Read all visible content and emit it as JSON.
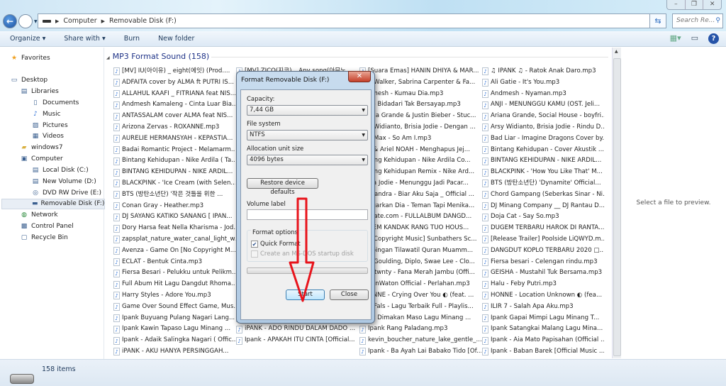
{
  "window": {
    "buttons": {
      "minimize": "–",
      "maximize": "❐",
      "close": "✕"
    }
  },
  "address": {
    "root": "Computer",
    "current": "Removable Disk (F:)",
    "search_placeholder": "Search Re..."
  },
  "toolbar": {
    "organize": "Organize ▾",
    "share": "Share with ▾",
    "burn": "Burn",
    "new_folder": "New folder"
  },
  "sidebar": {
    "items": [
      {
        "label": "Favorites",
        "icon": "star-icon"
      },
      {
        "label": "Desktop",
        "icon": "desktop-icon"
      },
      {
        "label": "Libraries",
        "icon": "libraries-icon"
      },
      {
        "label": "Documents",
        "icon": "documents-icon"
      },
      {
        "label": "Music",
        "icon": "music-icon"
      },
      {
        "label": "Pictures",
        "icon": "pictures-icon"
      },
      {
        "label": "Videos",
        "icon": "videos-icon"
      },
      {
        "label": "windows7",
        "icon": "user-folder-icon"
      },
      {
        "label": "Computer",
        "icon": "computer-icon"
      },
      {
        "label": "Local Disk (C:)",
        "icon": "disk-icon"
      },
      {
        "label": "New Volume (D:)",
        "icon": "disk-icon"
      },
      {
        "label": "DVD RW Drive (E:)",
        "icon": "dvd-icon"
      },
      {
        "label": "Removable Disk (F:)",
        "icon": "usb-drive-icon",
        "selected": true
      },
      {
        "label": "Network",
        "icon": "network-icon"
      },
      {
        "label": "Control Panel",
        "icon": "control-panel-icon"
      },
      {
        "label": "Recycle Bin",
        "icon": "recycle-bin-icon"
      }
    ]
  },
  "content": {
    "group_title": "MP3 Format Sound (158)",
    "columns": [
      [
        "[MV] IU(아이유) _ eight(에잇) (Prod....",
        "ADFAITA cover by ALMA ft PUTRI IS...",
        "ALLAHUL KAAFI _ FITRIANA feat NIS...",
        "Andmesh Kamaleng - Cinta Luar Bia...",
        "ANTASSALAM cover ALMA feat NIS...",
        "Arizona Zervas - ROXANNE.mp3",
        "AURELIE HERMANSYAH - KEPASTIA...",
        "Badai Romantic Project - Melamarm...",
        "Bintang Kehidupan - Nike Ardila ( Ta...",
        "BINTANG KEHIDUPAN - NIKE ARDIL...",
        "BLACKPINK - 'Ice Cream (with Selen...",
        "BTS (방탄소년단) '작은 것들을 위한 ...",
        "Conan Gray - Heather.mp3",
        "DJ SAYANG KATIKO SANANG [ IPAN...",
        "Dory Harsa feat Nella Kharisma - Jod...",
        "zapsplat_nature_water_canal_light_w...",
        "Avenza - Game On [No Copyright M...",
        "ECLAT - Bentuk Cinta.mp3",
        "Fiersa Besari - Pelukku untuk Pelikm...",
        "Full Abum Hit Lagu Dangdut Rhoma...",
        "Harry Styles - Adore You.mp3",
        "Game Over Sound Effect Game, Mus...",
        "Ipank   Buyuang Pulang Nagari Lang...",
        "Ipank   Kawin Tapaso Lagu Minang ...",
        "Ipank - Adaik Salingka Nagari ( Offic...",
        "iPANK - AKU HANYA PERSINGGAH..."
      ],
      [
        "[MV] ZICO(지코) _ Any song(아무노...",
        "",
        "",
        "",
        "",
        "",
        "",
        "",
        "",
        "",
        "",
        "",
        "",
        "",
        "",
        "",
        "",
        "",
        "",
        "",
        "",
        "",
        "Ipank   Maafkan Mande Lagu Minan...",
        "iPANK - ADO RINDU DALAM DADO ...",
        "Ipank - APAKAH ITU CINTA [Official..."
      ],
      [
        "[Suara Emas] HANIN DHIYA & MAR...",
        "n Walker, Sabrina Carpenter & Fa...",
        "dmesh - Kumau Dia.mp3",
        "ji - Bidadari Tak Bersayap.mp3",
        "ana Grande & Justin Bieber - Stuc...",
        "y Widianto, Brisia Jodie - Dengan ...",
        "a Max - So Am I.mp3",
        "L & Ariel NOAH - Menghapus Jej...",
        "tang Kehidupan - Nike Ardila Co...",
        "tang Kehidupan Remix - Nike Ard...",
        "sia Jodie - Menunggu Jadi Pacar...",
        "ssandra - Biar Aku Saja _ Official ...",
        "ngarkan Dia - Teman Tapi Menika...",
        "mate.com - FULLALBUM DANGD...",
        "GEM KANDAK RANG TUO HOUS...",
        "o Copyright Music] Sunbathers Sc...",
        "nbingan Tilawatil Quran Muamm...",
        "e Goulding, Diplo, Swae Lee - Clo...",
        "urtwnty - Fana Merah Jambu (Offi...",
        "yonWaton Official - Perlahan.mp3",
        "ONNE - Crying Over You ◐ (feat. ...",
        "n Fals - Lagu Terbaik Full - Playlis...",
        "nk   Dimakan Maso Lagu Minang ...",
        "Ipank   Rang Paladang.mp3",
        "kevin_boucher_nature_lake_gentle_...",
        "Ipank - Ba Ayah Lai Babako Tido [Of..."
      ],
      [
        "♫ IPANK ♫ - Ratok Anak Daro.mp3",
        "Ali Gatie - It's You.mp3",
        "Andmesh - Nyaman.mp3",
        "ANJI - MENUNGGU KAMU (OST. Jeli...",
        "Ariana Grande, Social House - boyfri...",
        "Arsy Widianto, Brisia Jodie - Rindu D...",
        "Bad Liar - Imagine Dragons Cover by...",
        "Bintang Kehidupan - Cover Akustik ...",
        "BINTANG KEHIDUPAN - NIKE ARDIL...",
        "BLACKPINK - 'How You Like That' M...",
        "BTS (방탄소년단) 'Dynamite' Official...",
        "Chord Gampang (Seberkas Sinar - Ni...",
        "DJ Minang Company __ DJ Rantau D...",
        "Doja Cat - Say So.mp3",
        "DUGEM TERBARU HAROK DI RANTA...",
        "[Release Trailer] Poolside LiQWYD.m...",
        "DANGDUT KOPLO TERBARU 2020 □...",
        "Fiersa besari - Celengan rindu.mp3",
        "GEISHA - Mustahil Tuk Bersama.mp3",
        "Halu - Feby Putri.mp3",
        "HONNE - Location Unknown ◐ (fea...",
        "ILIR 7 - Salah Apa Aku.mp3",
        "Ipank   Gapai Mimpi Lagu Minang T...",
        "Ipank   Satangkai Malang Lagu Mina...",
        "Ipank - Aia Mato Papisahan (Official ...",
        "Ipank - Baban Barek [Official Music ..."
      ]
    ]
  },
  "preview": {
    "text": "Select a file to preview."
  },
  "status": {
    "count": "158 items"
  },
  "dialog": {
    "title": "Format Removable Disk (F:)",
    "close": "✕",
    "capacity_label": "Capacity:",
    "capacity_value": "7,44 GB",
    "fs_label": "File system",
    "fs_value": "NTFS",
    "alloc_label": "Allocation unit size",
    "alloc_value": "4096 bytes",
    "restore": "Restore device defaults",
    "volume_label": "Volume label",
    "volume_value": "",
    "options_label": "Format options",
    "quick_format": "Quick Format",
    "quick_format_checked": true,
    "msdos": "Create an MS-DOS startup disk",
    "msdos_checked": false,
    "progress": 0,
    "start": "Start",
    "close_btn": "Close"
  },
  "annotation": {
    "arrow_color": "#e8141c"
  }
}
